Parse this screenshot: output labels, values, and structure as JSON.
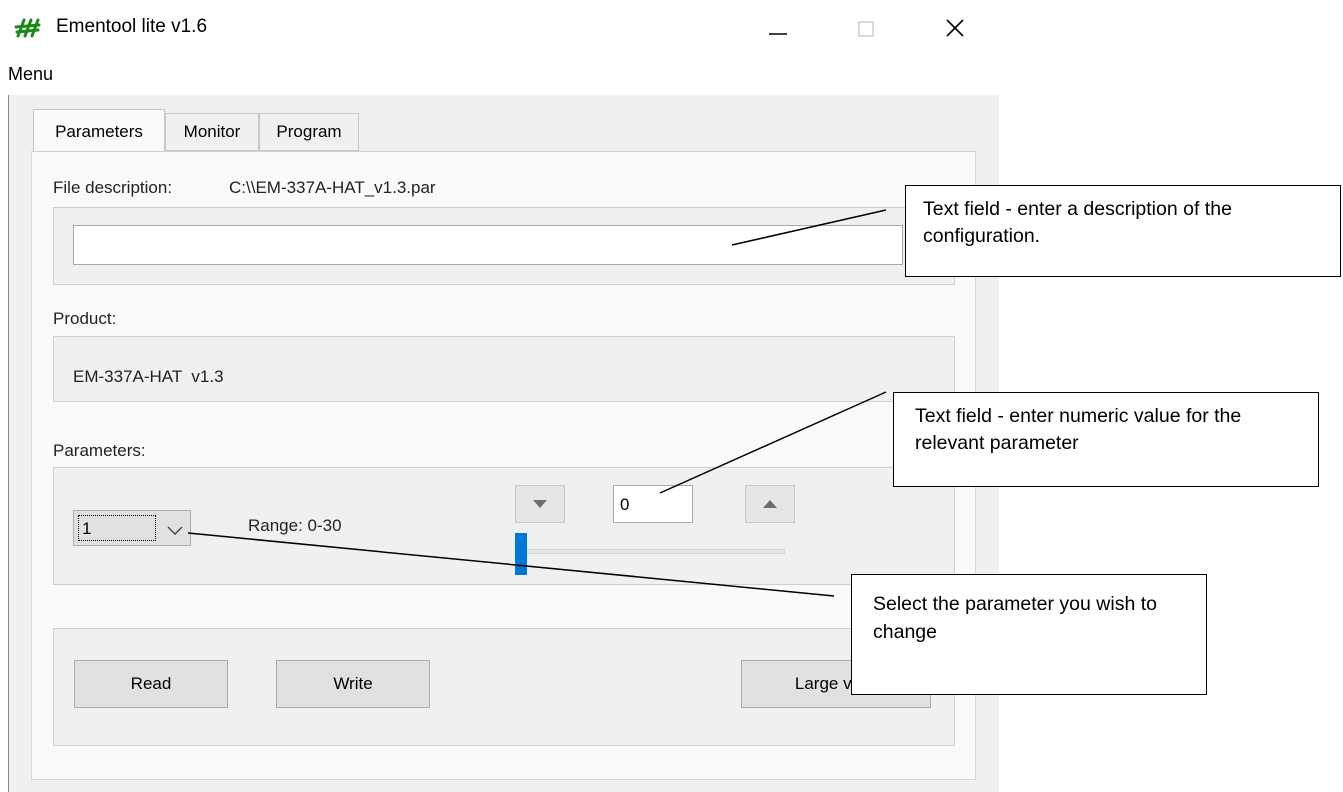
{
  "window": {
    "title": "Ementool lite v1.6",
    "minimize_glyph": "—",
    "close_glyph": "✕",
    "logo_color": "#1a8a1a"
  },
  "menu": {
    "label": "Menu"
  },
  "tabs": [
    {
      "label": "Parameters",
      "active": true
    },
    {
      "label": "Monitor",
      "active": false
    },
    {
      "label": "Program",
      "active": false
    }
  ],
  "file": {
    "label": "File description:",
    "path": "C:\\\\EM-337A-HAT_v1.3.par",
    "description_value": ""
  },
  "product": {
    "label": "Product:",
    "value": "EM-337A-HAT  v1.3"
  },
  "parameters": {
    "label": "Parameters:",
    "selected": "1",
    "range_text": "Range: 0-30",
    "value": "0",
    "slider_fraction": 0,
    "accent_color": "#0078d7"
  },
  "buttons": {
    "read": "Read",
    "write": "Write",
    "large_view": "Large view"
  },
  "callouts": {
    "description": "Text field - enter a description of the configuration.",
    "numeric": "Text field - enter numeric value for the relevant parameter",
    "select": "Select the parameter you wish to change"
  }
}
